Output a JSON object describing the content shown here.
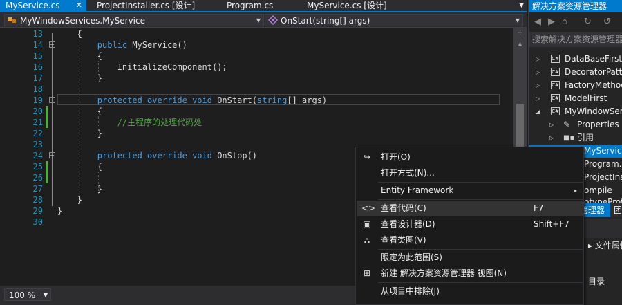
{
  "tabs": [
    {
      "label": "MyService.cs",
      "active": true
    },
    {
      "label": "ProjectInstaller.cs [设计]",
      "active": false
    },
    {
      "label": "Program.cs",
      "active": false
    },
    {
      "label": "MyService.cs [设计]",
      "active": false
    }
  ],
  "tab_close": "✕",
  "tab_overflow": "▼",
  "navbar": {
    "class_combo": "MyWindowServices.MyService",
    "member_combo": "OnStart(string[] args)"
  },
  "editor": {
    "lines": [
      {
        "num": "13",
        "code": "    {"
      },
      {
        "num": "14",
        "code": "        public MyService()"
      },
      {
        "num": "15",
        "code": "        {"
      },
      {
        "num": "16",
        "code": "            InitializeComponent();"
      },
      {
        "num": "17",
        "code": "        }"
      },
      {
        "num": "18",
        "code": ""
      },
      {
        "num": "19",
        "code": "        protected override void OnStart(string[] args)"
      },
      {
        "num": "20",
        "code": "        {"
      },
      {
        "num": "21",
        "code": "            //主程序的处理代码处"
      },
      {
        "num": "22",
        "code": "        }"
      },
      {
        "num": "23",
        "code": ""
      },
      {
        "num": "24",
        "code": "        protected override void OnStop()"
      },
      {
        "num": "25",
        "code": "        {"
      },
      {
        "num": "26",
        "code": ""
      },
      {
        "num": "27",
        "code": "        }"
      },
      {
        "num": "28",
        "code": "    }"
      },
      {
        "num": "29",
        "code": "}"
      },
      {
        "num": "30",
        "code": ""
      }
    ],
    "keyword_color": "#569cd6",
    "comment_color": "#57a64a",
    "line_number_color": "#2b91af"
  },
  "zoom": "100 %",
  "solution_explorer": {
    "title": "解决方案资源管理器",
    "search_placeholder": "搜索解决方案资源管理器",
    "items": [
      {
        "label": "DataBaseFirst",
        "icon": "C#"
      },
      {
        "label": "DecoratorPatte",
        "icon": "C#"
      },
      {
        "label": "FactoryMethod",
        "icon": "C#"
      },
      {
        "label": "ModelFirst",
        "icon": "C#"
      },
      {
        "label": "MyWindowSer",
        "icon": "C#"
      },
      {
        "label": "Properties",
        "icon": "wrench"
      },
      {
        "label": "引用",
        "icon": "references"
      },
      {
        "label": "MyService.c",
        "icon": "cs-file"
      },
      {
        "label": "Program.cs",
        "icon": "cs-file"
      },
      {
        "label": "ProjectInsta",
        "icon": "cs-file"
      },
      {
        "label": "ompile",
        "icon": ""
      },
      {
        "label": "otypeProtto",
        "icon": ""
      }
    ],
    "bottom_tabs": [
      "管理器",
      "团"
    ],
    "property_label": "文件属性",
    "dir_label": "目录"
  },
  "context_menu": {
    "items": [
      {
        "label": "打开(O)",
        "key": "",
        "icon": "open-icon"
      },
      {
        "label": "打开方式(N)...",
        "key": "",
        "icon": ""
      },
      {
        "label": "Entity Framework",
        "key": "",
        "icon": "",
        "submenu": "▸"
      },
      {
        "label": "查看代码(C)",
        "key": "F7",
        "icon": "code-icon"
      },
      {
        "label": "查看设计器(D)",
        "key": "Shift+F7",
        "icon": "designer-icon"
      },
      {
        "label": "查看类图(V)",
        "key": "",
        "icon": "class-diagram-icon"
      },
      {
        "label": "限定为此范围(S)",
        "key": "",
        "icon": ""
      },
      {
        "label": "新建 解决方案资源管理器 视图(N)",
        "key": "",
        "icon": "new-view-icon"
      },
      {
        "label": "从项目中排除(J)",
        "key": "",
        "icon": ""
      }
    ]
  }
}
